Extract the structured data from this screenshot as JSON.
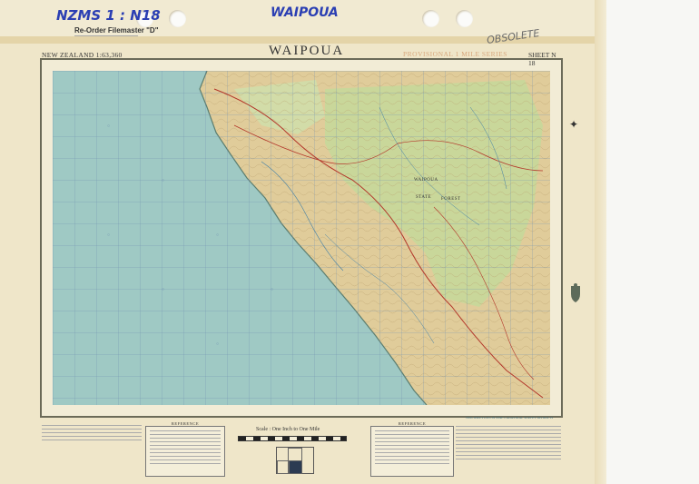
{
  "handwriting": {
    "code": "NZMS 1 : N18",
    "name": "WAIPOUA",
    "status": "OBSOLETE"
  },
  "reorder": {
    "label": "Re-Order Filemaster \"D\""
  },
  "map_header": {
    "left": "NEW ZEALAND 1:63,360",
    "title": "WAIPOUA",
    "series": "PROVISIONAL 1 MILE SERIES",
    "sheet": "SHEET N 18"
  },
  "map_labels": {
    "forest_1": "WAIPOUA",
    "forest_2": "STATE",
    "forest_3": "FOREST"
  },
  "legend": {
    "reference_left": "REFERENCE",
    "reference_right": "REFERENCE",
    "scale": "Scale : One Inch to One Mile",
    "right_panel_title": "THIS SHEET LIES IN NINE CADASTRAL SURVEY DISTRICTS"
  },
  "colors": {
    "sea": "#9fc9c4",
    "land_green": "#c9d79a",
    "land_tan": "#e0cc9a",
    "grid": "#6f8fb0",
    "road": "#b3362a",
    "frame": "#6b6a58",
    "handwriting": "#2b3fb3"
  }
}
